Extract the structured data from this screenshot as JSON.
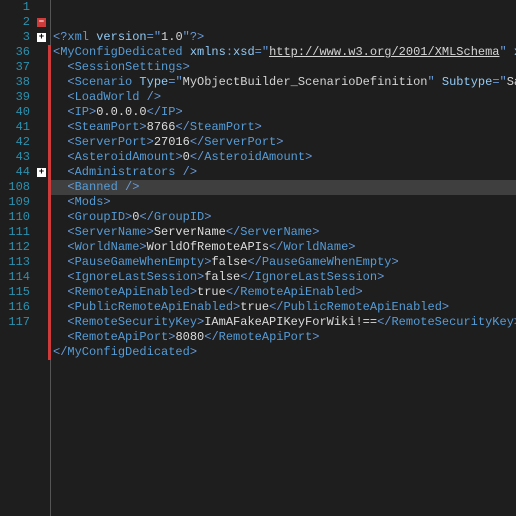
{
  "lineNumbers": [
    1,
    2,
    3,
    36,
    37,
    38,
    39,
    40,
    41,
    42,
    43,
    44,
    108,
    109,
    110,
    111,
    112,
    113,
    114,
    115,
    116,
    117
  ],
  "folds": {
    "1": {
      "type": "minus",
      "sym": "−"
    },
    "2": {
      "type": "plus",
      "sym": "+"
    },
    "11": {
      "type": "plus",
      "sym": "+"
    }
  },
  "lines": [
    {
      "indent": 0,
      "raw": "<?xml version=\"1.0\"?>",
      "html": "<span class='t-xml'>&lt;?</span><span class='t-tag'>xml</span> <span class='t-attr'>version</span><span class='t-delim'>=</span><span class='t-delim'>\"</span><span class='t-str'>1.0</span><span class='t-delim'>\"</span><span class='t-xml'>?&gt;</span>"
    },
    {
      "indent": 0,
      "db": "l.1",
      "text": "<MyConfigDedicated xmlns:xsd=\"http://www.w3.org/2001/XMLSchema\" x…",
      "html": "<span class='t-delim'>&lt;</span><span class='t-tag'>MyConfigDedicated</span> <span class='t-attr'>xmlns</span><span class='t-delim'>:</span><span class='t-attr'>xsd</span><span class='t-delim'>=</span><span class='t-delim'>\"</span><span class='t-link'>http://www.w3.org/2001/XMLSchema</span><span class='t-delim'>\"</span> <span class='t-attr'>x</span>"
    },
    {
      "indent": 1,
      "html": "<span class='t-delim'>&lt;</span><span class='t-tag'>SessionSettings</span><span class='t-delim'>&gt;</span>"
    },
    {
      "indent": 1,
      "html": "<span class='t-delim'>&lt;</span><span class='t-tag'>Scenario</span> <span class='t-attr'>Type</span><span class='t-delim'>=</span><span class='t-delim'>\"</span><span class='t-str'>MyObjectBuilder_ScenarioDefinition</span><span class='t-delim'>\"</span> <span class='t-attr'>Subtype</span><span class='t-delim'>=</span><span class='t-delim'>\"</span><span class='t-str'>Sa</span>"
    },
    {
      "indent": 1,
      "html": "<span class='t-delim'>&lt;</span><span class='t-tag'>LoadWorld</span> <span class='t-delim'>/&gt;</span>"
    },
    {
      "indent": 1,
      "html": "<span class='t-delim'>&lt;</span><span class='t-tag'>IP</span><span class='t-delim'>&gt;</span><span class='t-txt'>0.0.0.0</span><span class='t-delim'>&lt;/</span><span class='t-close'>IP</span><span class='t-delim'>&gt;</span>"
    },
    {
      "indent": 1,
      "html": "<span class='t-delim'>&lt;</span><span class='t-tag'>SteamPort</span><span class='t-delim'>&gt;</span><span class='t-txt'>8766</span><span class='t-delim'>&lt;/</span><span class='t-close'>SteamPort</span><span class='t-delim'>&gt;</span>"
    },
    {
      "indent": 1,
      "html": "<span class='t-delim'>&lt;</span><span class='t-tag'>ServerPort</span><span class='t-delim'>&gt;</span><span class='t-txt'>27016</span><span class='t-delim'>&lt;/</span><span class='t-close'>ServerPort</span><span class='t-delim'>&gt;</span>"
    },
    {
      "indent": 1,
      "html": "<span class='t-delim'>&lt;</span><span class='t-tag'>AsteroidAmount</span><span class='t-delim'>&gt;</span><span class='t-txt'>0</span><span class='t-delim'>&lt;/</span><span class='t-close'>AsteroidAmount</span><span class='t-delim'>&gt;</span>"
    },
    {
      "indent": 1,
      "html": "<span class='t-delim'>&lt;</span><span class='t-tag'>Administrators</span> <span class='t-delim'>/&gt;</span>"
    },
    {
      "indent": 1,
      "sel": true,
      "html": "<span class='t-delim'>&lt;</span><span class='t-tag'>Banned</span> <span class='t-delim'>/&gt;</span>"
    },
    {
      "indent": 1,
      "html": "<span class='t-delim'>&lt;</span><span class='t-tag'>Mods</span><span class='t-delim'>&gt;</span>"
    },
    {
      "indent": 1,
      "html": "<span class='t-delim'>&lt;</span><span class='t-tag'>GroupID</span><span class='t-delim'>&gt;</span><span class='t-txt'>0</span><span class='t-delim'>&lt;/</span><span class='t-close'>GroupID</span><span class='t-delim'>&gt;</span>"
    },
    {
      "indent": 1,
      "html": "<span class='t-delim'>&lt;</span><span class='t-tag'>ServerName</span><span class='t-delim'>&gt;</span><span class='t-txt'>ServerName</span><span class='t-delim'>&lt;/</span><span class='t-close'>ServerName</span><span class='t-delim'>&gt;</span>"
    },
    {
      "indent": 1,
      "html": "<span class='t-delim'>&lt;</span><span class='t-tag'>WorldName</span><span class='t-delim'>&gt;</span><span class='t-txt'>WorldOfRemoteAPIs</span><span class='t-delim'>&lt;/</span><span class='t-close'>WorldName</span><span class='t-delim'>&gt;</span>"
    },
    {
      "indent": 1,
      "html": "<span class='t-delim'>&lt;</span><span class='t-tag'>PauseGameWhenEmpty</span><span class='t-delim'>&gt;</span><span class='t-txt'>false</span><span class='t-delim'>&lt;/</span><span class='t-close'>PauseGameWhenEmpty</span><span class='t-delim'>&gt;</span>"
    },
    {
      "indent": 1,
      "html": "<span class='t-delim'>&lt;</span><span class='t-tag'>IgnoreLastSession</span><span class='t-delim'>&gt;</span><span class='t-txt'>false</span><span class='t-delim'>&lt;/</span><span class='t-close'>IgnoreLastSession</span><span class='t-delim'>&gt;</span>"
    },
    {
      "indent": 1,
      "html": "<span class='t-delim'>&lt;</span><span class='t-tag'>RemoteApiEnabled</span><span class='t-delim'>&gt;</span><span class='t-txt'>true</span><span class='t-delim'>&lt;/</span><span class='t-close'>RemoteApiEnabled</span><span class='t-delim'>&gt;</span>"
    },
    {
      "indent": 1,
      "html": "<span class='t-delim'>&lt;</span><span class='t-tag'>PublicRemoteApiEnabled</span><span class='t-delim'>&gt;</span><span class='t-txt'>true</span><span class='t-delim'>&lt;/</span><span class='t-close'>PublicRemoteApiEnabled</span><span class='t-delim'>&gt;</span>"
    },
    {
      "indent": 1,
      "html": "<span class='t-delim'>&lt;</span><span class='t-tag'>RemoteSecurityKey</span><span class='t-delim'>&gt;</span><span class='t-txt'>IAmAFakeAPIKeyForWiki!==</span><span class='t-delim'>&lt;/</span><span class='t-close'>RemoteSecurityKey</span><span class='t-delim'>&gt;</span>"
    },
    {
      "indent": 1,
      "html": "<span class='t-delim'>&lt;</span><span class='t-tag'>RemoteApiPort</span><span class='t-delim'>&gt;</span><span class='t-txt'>8080</span><span class='t-delim'>&lt;/</span><span class='t-close'>RemoteApiPort</span><span class='t-delim'>&gt;</span>"
    },
    {
      "indent": 0,
      "html": "<span class='t-delim'>&lt;/</span><span class='t-close'>MyConfigDedicated</span><span class='t-delim'>&gt;</span>"
    }
  ]
}
